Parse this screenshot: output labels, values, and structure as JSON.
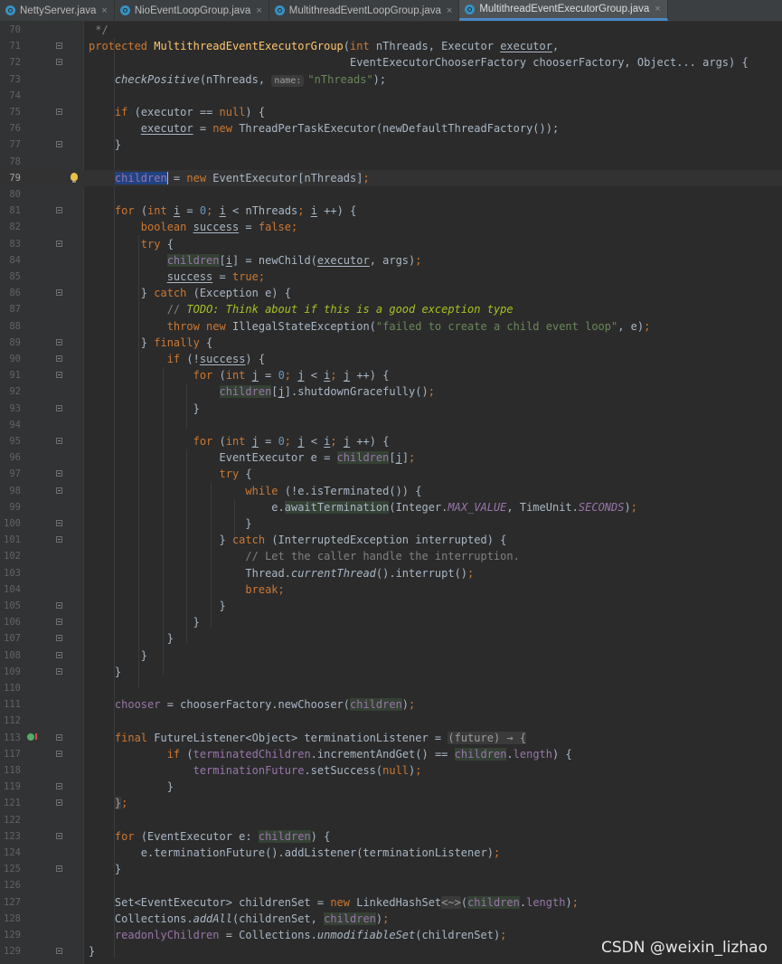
{
  "tabs": [
    {
      "label": "NettyServer.java",
      "active": false
    },
    {
      "label": "NioEventLoopGroup.java",
      "active": false
    },
    {
      "label": "MultithreadEventLoopGroup.java",
      "active": false
    },
    {
      "label": "MultithreadEventExecutorGroup.java",
      "active": true
    }
  ],
  "tab_close_glyph": "×",
  "line_numbers": [
    "70",
    "71",
    "72",
    "73",
    "74",
    "75",
    "76",
    "77",
    "78",
    "79",
    "80",
    "81",
    "82",
    "83",
    "84",
    "85",
    "86",
    "87",
    "88",
    "89",
    "90",
    "91",
    "92",
    "93",
    "94",
    "95",
    "96",
    "97",
    "98",
    "99",
    "100",
    "101",
    "102",
    "103",
    "104",
    "105",
    "106",
    "107",
    "108",
    "109",
    "110",
    "111",
    "112",
    "113",
    "117",
    "118",
    "119",
    "121",
    "122",
    "123",
    "124",
    "125",
    "126",
    "127",
    "128",
    "129"
  ],
  "current_line": "79",
  "code": {
    "l71_method": "MultithreadEventExecutorGroup",
    "l88_message": "\"failed to create a child event loop\"",
    "l87_todo": "TODO: Think about if this is a good exception type",
    "l102_comment": "// Let the caller handle the interruption.",
    "l73_param_hint": "name:",
    "l73_string": "\"nThreads\""
  },
  "watermark": "CSDN @weixin_lizhao"
}
